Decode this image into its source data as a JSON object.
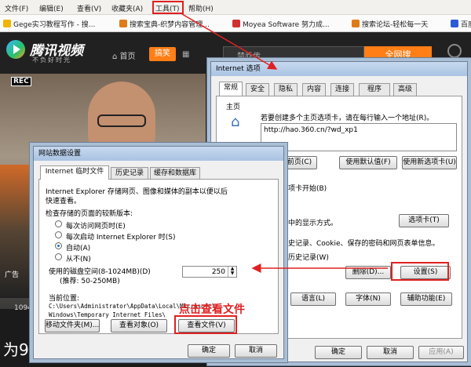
{
  "menubar": {
    "items": [
      "文件(F)",
      "编辑(E)",
      "查看(V)",
      "收藏夹(A)",
      "工具(T)",
      "帮助(H)"
    ]
  },
  "favorites": [
    "Gege实习教程写作 - 搜...",
    "搜索宝典-织梦内容管理...",
    "Moyea Software 努力成...",
    "搜索论坛-轻松每一天",
    "百度"
  ],
  "site": {
    "logo": "腾讯视频",
    "slogan": "不负好时光",
    "home": "首页",
    "hot": "搞笑",
    "search": "楚乔传",
    "search_button": "全网搜",
    "rec": "REC",
    "ad": "广告",
    "count": "1094",
    "bigtext": "为9"
  },
  "internet_options": {
    "title": "Internet 选项",
    "tabs": [
      "常规",
      "安全",
      "隐私",
      "内容",
      "连接",
      "程序",
      "高级"
    ],
    "homepage_label": "主页",
    "homepage_hint": "若要创建多个主页选项卡，请在每行输入一个地址(R)。",
    "homepage_url": "http://hao.360.cn/?wd_xp1",
    "btn_current": "使用当前页(C)",
    "btn_default": "使用默认值(F)",
    "btn_new": "使用新选项卡(U)",
    "startup_text": "选项卡开始(B)",
    "tabs_text": "卡中的显示方式。",
    "btn_tabs": "选项卡(T)",
    "history_text": "历史记录、Cookie、保存的密码和网页表单信息。",
    "history_sub": "览历史记录(W)",
    "btn_delete": "删除(D)...",
    "btn_settings": "设置(S)",
    "btn_language": "语言(L)",
    "btn_font": "字体(N)",
    "btn_access": "辅助功能(E)",
    "btn_ok": "确定",
    "btn_cancel": "取消",
    "btn_apply": "应用(A)"
  },
  "website_data": {
    "title": "网站数据设置",
    "tabs": [
      "Internet 临时文件",
      "历史记录",
      "缓存和数据库"
    ],
    "desc1": "Internet Explorer 存储网页、图像和媒体的副本以便以后",
    "desc2": "快速查看。",
    "check_label": "检查存储的页面的较新版本:",
    "options": [
      "每次访问网页时(E)",
      "每次启动 Internet Explorer 时(S)",
      "自动(A)",
      "从不(N)"
    ],
    "disk_label": "使用的磁盘空间(8-1024MB)(D)",
    "disk_hint": "(推荐: 50-250MB)",
    "disk_value": "250",
    "location_label": "当前位置:",
    "path1": "C:\\Users\\Administrator\\AppData\\Local\\Microsoft\\",
    "path2": "Windows\\Temporary Internet Files\\",
    "btn_move": "移动文件夹(M)...",
    "btn_objects": "查看对象(O)",
    "btn_files": "查看文件(V)",
    "btn_ok": "确定",
    "btn_cancel": "取消"
  },
  "annotation": "点击查看文件",
  "colors": {
    "annotation": "#e02020",
    "accent": "#ff7e16"
  }
}
